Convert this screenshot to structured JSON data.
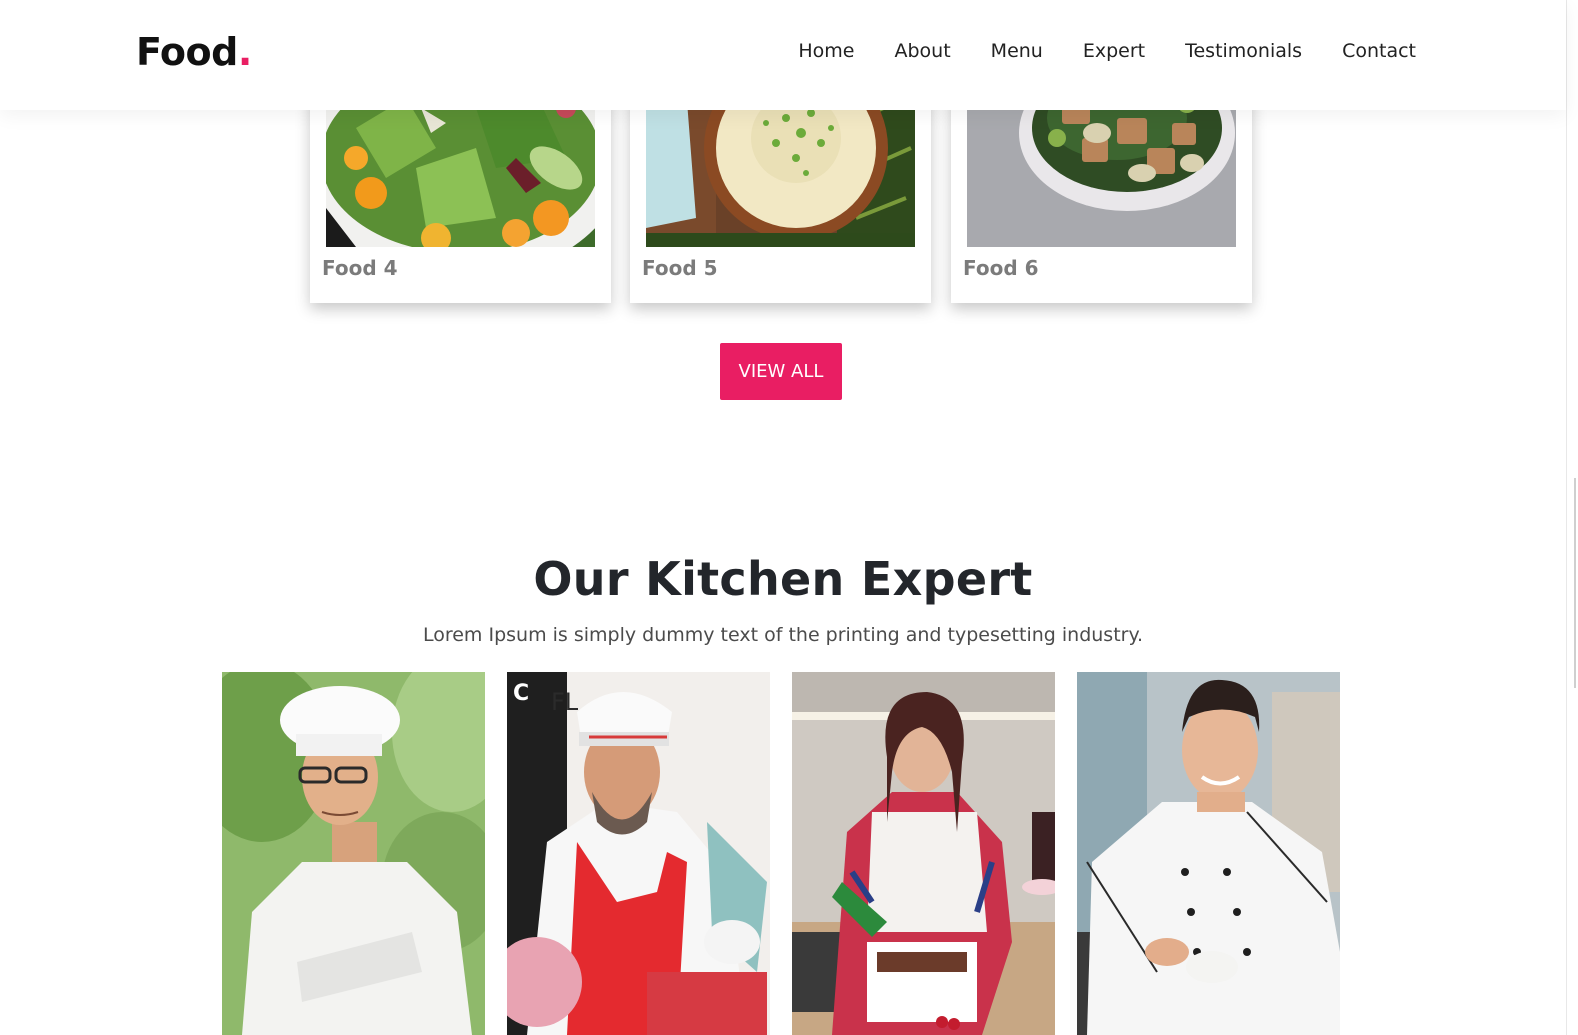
{
  "header": {
    "logo_text": "Food",
    "logo_dot": ".",
    "nav": [
      "Home",
      "About",
      "Menu",
      "Expert",
      "Testimonials",
      "Contact"
    ]
  },
  "food_cards": [
    {
      "title": "Food 4",
      "image": "salad-photo"
    },
    {
      "title": "Food 5",
      "image": "soup-bowl-photo"
    },
    {
      "title": "Food 6",
      "image": "tofu-bowl-photo"
    }
  ],
  "view_all_label": "VIEW ALL",
  "expert_section": {
    "title": "Our Kitchen Expert",
    "subtitle": "Lorem Ipsum is simply dummy text of the printing and typesetting industry.",
    "experts": [
      {
        "image": "chef-arms-crossed-photo"
      },
      {
        "image": "chef-red-apron-photo"
      },
      {
        "image": "pastry-chef-woman-photo"
      },
      {
        "image": "chef-with-cup-photo"
      }
    ]
  },
  "colors": {
    "accent": "#e91e63",
    "heading": "#23262b",
    "card_title": "#7b7b7b"
  }
}
